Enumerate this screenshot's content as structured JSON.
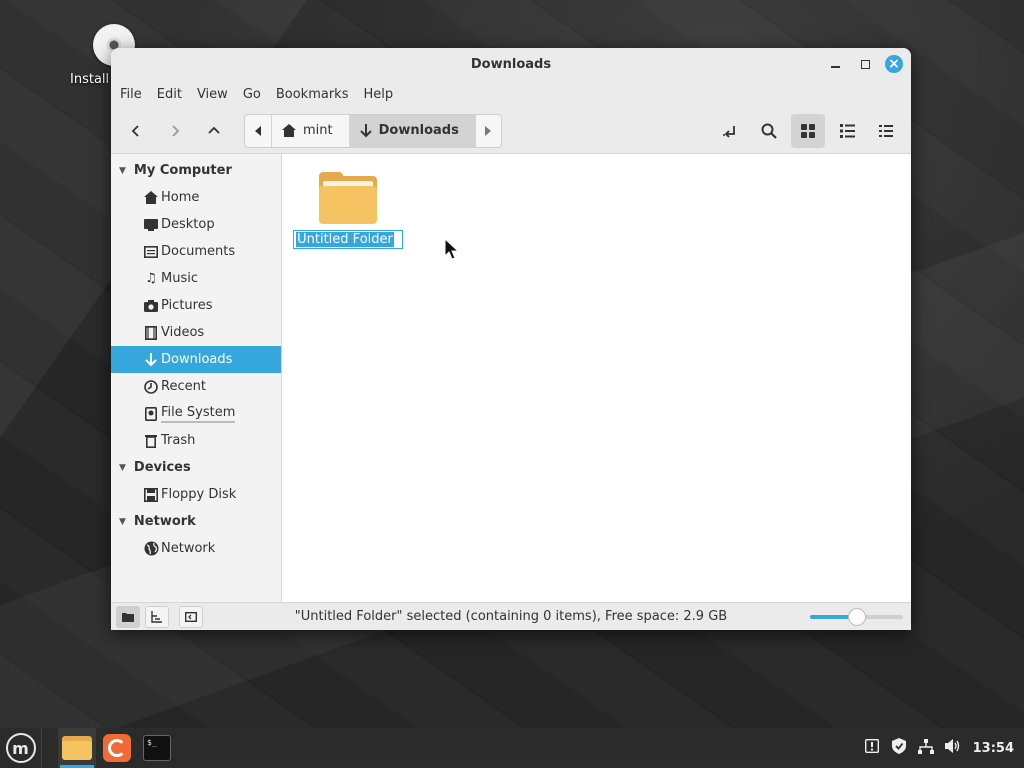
{
  "desktop": {
    "icon_label": "Install"
  },
  "window": {
    "title": "Downloads",
    "menu": [
      "File",
      "Edit",
      "View",
      "Go",
      "Bookmarks",
      "Help"
    ]
  },
  "pathbar": {
    "crumbs": [
      "mint",
      "Downloads"
    ]
  },
  "sidebar": {
    "sections": [
      {
        "title": "My Computer",
        "items": [
          "Home",
          "Desktop",
          "Documents",
          "Music",
          "Pictures",
          "Videos",
          "Downloads",
          "Recent",
          "File System",
          "Trash"
        ]
      },
      {
        "title": "Devices",
        "items": [
          "Floppy Disk"
        ]
      },
      {
        "title": "Network",
        "items": [
          "Network"
        ]
      }
    ],
    "selected": "Downloads"
  },
  "content": {
    "items": [
      {
        "name": "Untitled Folder",
        "type": "folder",
        "renaming": true
      }
    ]
  },
  "statusbar": {
    "text": "\"Untitled Folder\" selected (containing 0 items), Free space: 2.9 GB",
    "zoom_fraction": 0.5
  },
  "taskbar": {
    "clock": "13:54"
  },
  "colors": {
    "accent": "#35a7dc",
    "folder": "#f6c362"
  },
  "icons": {
    "back": "chevron-left-icon",
    "forward": "chevron-right-icon",
    "up": "chevron-up-icon",
    "toggle_location": "location-toggle-icon",
    "search": "search-icon",
    "icon_view": "grid-view-icon",
    "list_view": "list-view-icon",
    "compact_view": "compact-view-icon"
  }
}
